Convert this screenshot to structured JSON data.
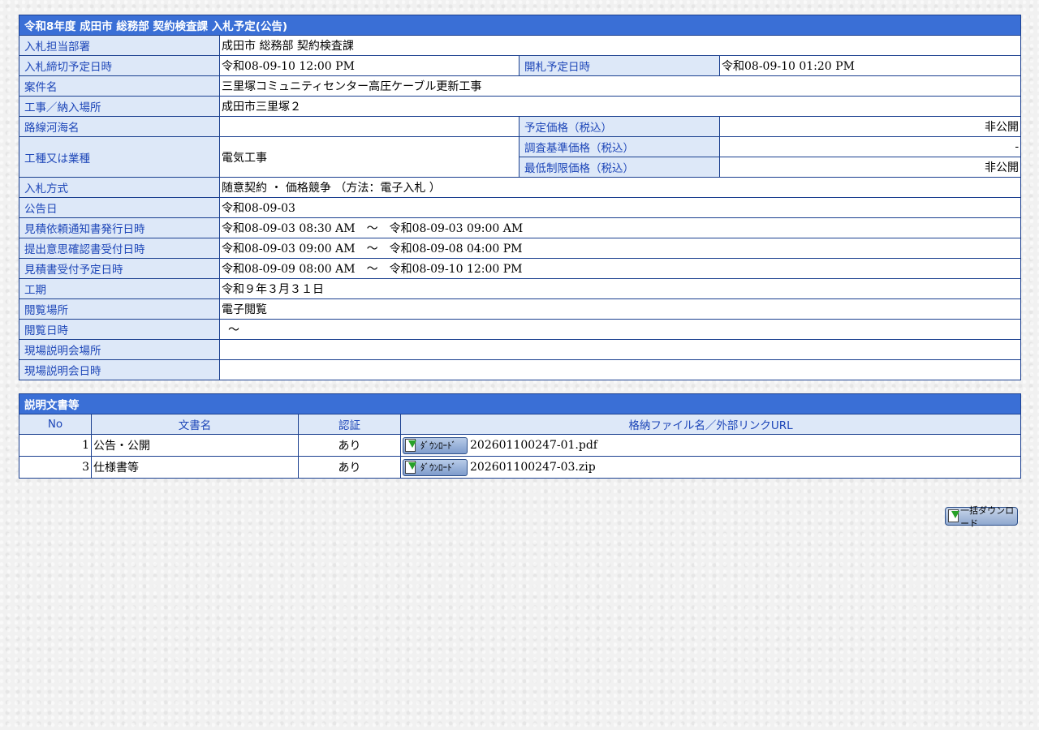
{
  "notice": {
    "title": "令和8年度 成田市 総務部 契約検査課 入札予定(公告)",
    "rows": {
      "dept": {
        "label": "入札担当部署",
        "value": "成田市 総務部 契約検査課"
      },
      "deadline": {
        "label": "入札締切予定日時",
        "value": "令和08-09-10 12:00 PM"
      },
      "opening": {
        "label": "開札予定日時",
        "value": "令和08-09-10 01:20 PM"
      },
      "case_name": {
        "label": "案件名",
        "value": "三里塚コミュニティセンター高圧ケーブル更新工事"
      },
      "location": {
        "label": "工事／納入場所",
        "value": "成田市三里塚２"
      },
      "route": {
        "label": "路線河海名",
        "value": ""
      },
      "planned_price": {
        "label": "予定価格（税込）",
        "value": "非公開"
      },
      "work_type": {
        "label": "工種又は業種",
        "value": "電気工事"
      },
      "survey_price": {
        "label": "調査基準価格（税込）",
        "value": "-"
      },
      "min_price": {
        "label": "最低制限価格（税込）",
        "value": "非公開"
      },
      "method": {
        "label": "入札方式",
        "value": "随意契約 ・ 価格競争 （方法：電子入札 ）"
      },
      "announce_date": {
        "label": "公告日",
        "value": "令和08-09-03"
      },
      "estimate_notice": {
        "label": "見積依頼通知書発行日時",
        "value": "令和08-09-03 08:30 AM　～　令和08-09-03 09:00 AM"
      },
      "intent_receipt": {
        "label": "提出意思確認書受付日時",
        "value": "令和08-09-03 09:00 AM　～　令和08-09-08 04:00 PM"
      },
      "estimate_receipt": {
        "label": "見積書受付予定日時",
        "value": "令和08-09-09 08:00 AM　～　令和08-09-10 12:00 PM"
      },
      "period": {
        "label": "工期",
        "value": "令和９年３月３１日"
      },
      "view_place": {
        "label": "閲覧場所",
        "value": "電子閲覧"
      },
      "view_date": {
        "label": "閲覧日時",
        "value": "～"
      },
      "site_place": {
        "label": "現場説明会場所",
        "value": ""
      },
      "site_date": {
        "label": "現場説明会日時",
        "value": ""
      }
    }
  },
  "documents": {
    "title": "説明文書等",
    "columns": {
      "no": "No",
      "name": "文書名",
      "cert": "認証",
      "file": "格納ファイル名／外部リンクURL"
    },
    "download_label": "ﾀﾞｳﾝﾛｰﾄﾞ",
    "items": [
      {
        "no": "1",
        "name": "公告・公開",
        "cert": "あり",
        "file": "202601100247-01.pdf"
      },
      {
        "no": "3",
        "name": "仕様書等",
        "cert": "あり",
        "file": "202601100247-03.zip"
      }
    ]
  },
  "bulk_download_label": "一括ダウンロード",
  "colors": {
    "header": "#3a6fd6",
    "label_bg": "#dde8f8",
    "label_text": "#1d46b8",
    "border": "#1a3f8f"
  }
}
